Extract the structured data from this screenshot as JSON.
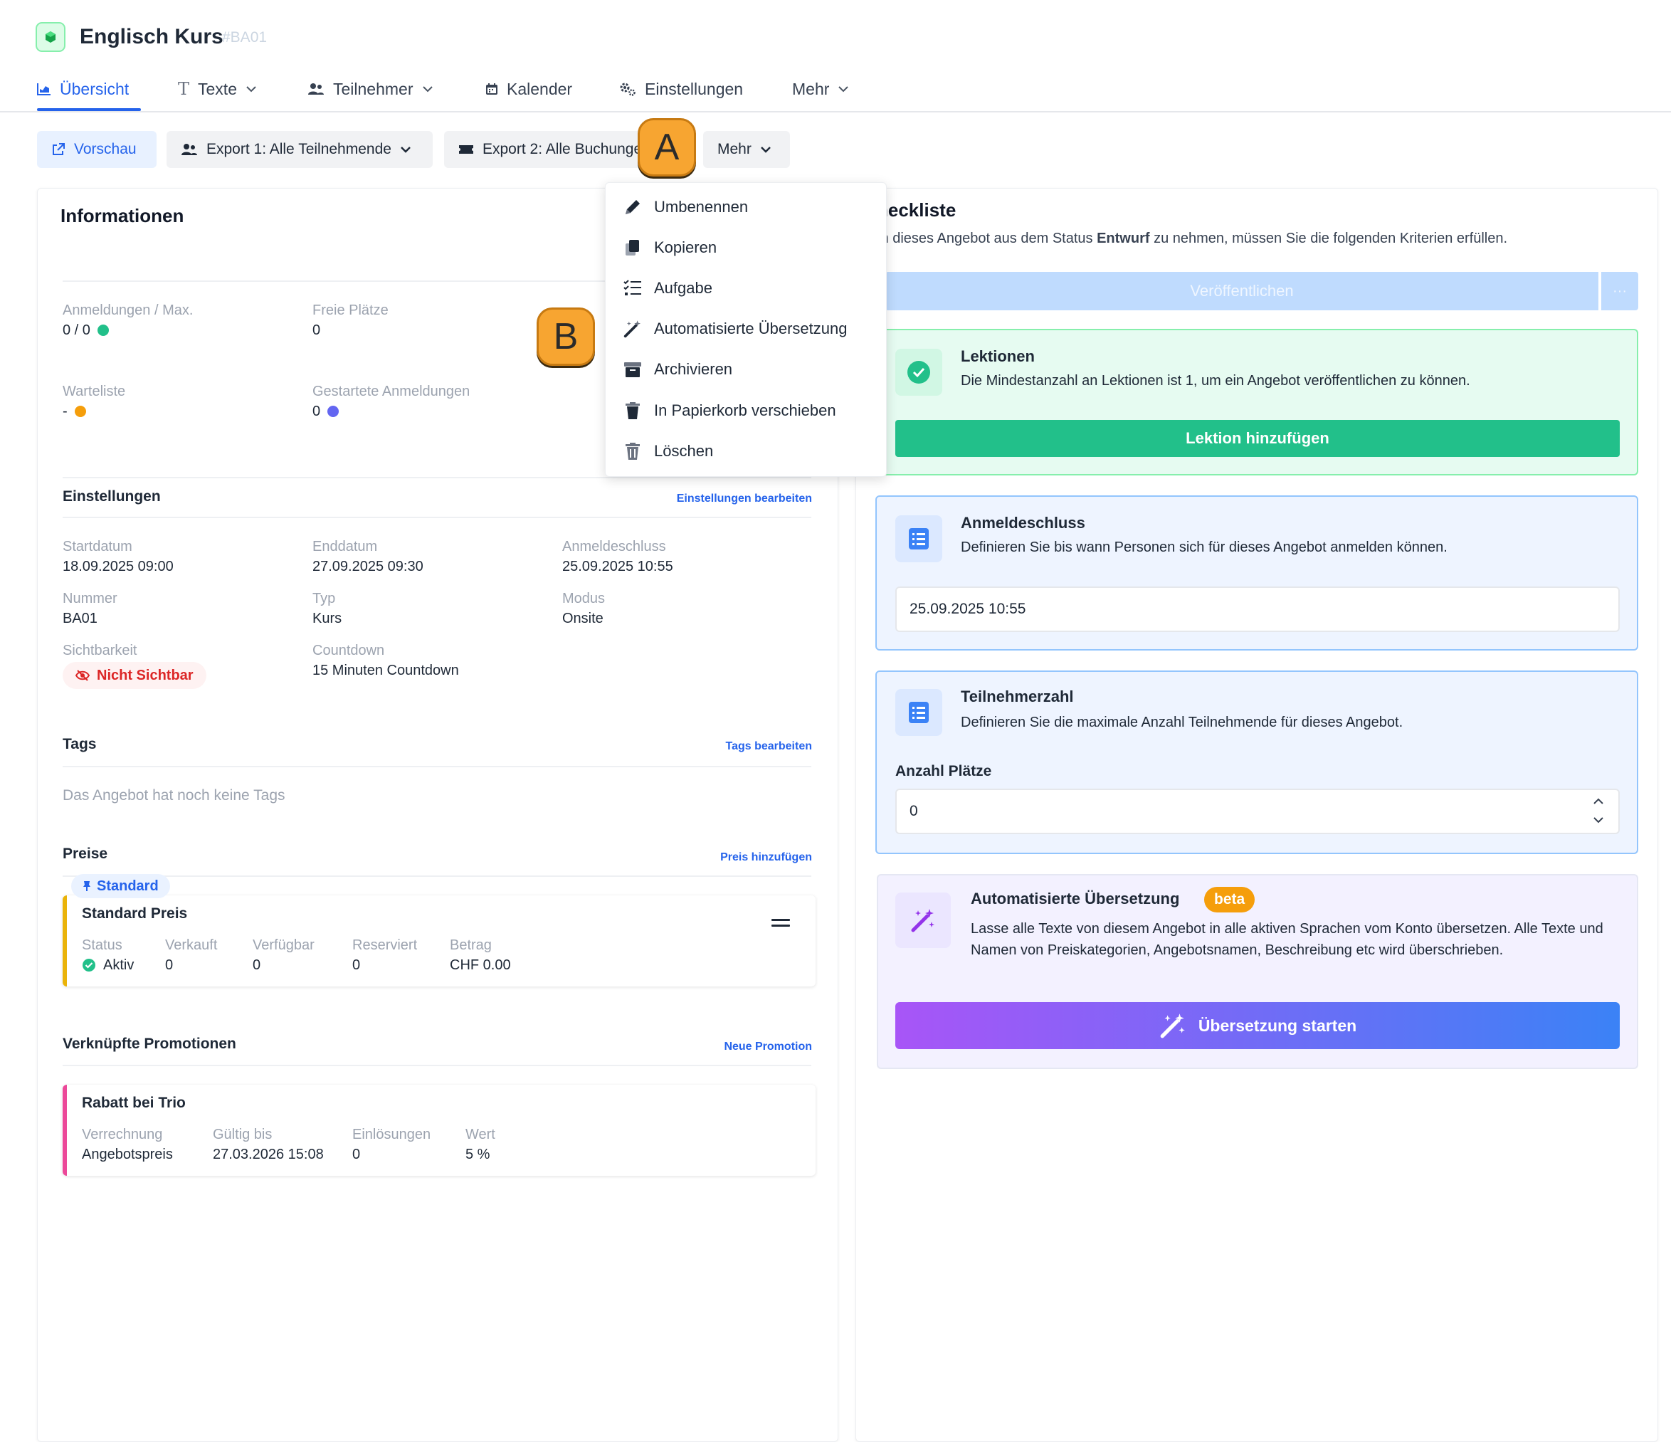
{
  "header": {
    "title": "Englisch Kurs",
    "code": "#BA01"
  },
  "tabs": [
    {
      "label": "Übersicht",
      "icon": "chart-icon",
      "active": true
    },
    {
      "label": "Texte",
      "icon": "text-icon",
      "dropdown": true
    },
    {
      "label": "Teilnehmer",
      "icon": "users-icon",
      "dropdown": true
    },
    {
      "label": "Kalender",
      "icon": "calendar-icon"
    },
    {
      "label": "Einstellungen",
      "icon": "gears-icon"
    },
    {
      "label": "Mehr",
      "dropdown": true
    }
  ],
  "toolbar": {
    "preview": "Vorschau",
    "export1": "Export 1: Alle Teilnehmende",
    "export2": "Export 2: Alle Buchunge",
    "more": "Mehr"
  },
  "markers": {
    "a": "A",
    "b": "B"
  },
  "menu": [
    {
      "label": "Umbenennen",
      "icon": "pencil-icon"
    },
    {
      "label": "Kopieren",
      "icon": "copy-icon"
    },
    {
      "label": "Aufgabe",
      "icon": "task-list-icon"
    },
    {
      "label": "Automatisierte Übersetzung",
      "icon": "magic-wand-icon"
    },
    {
      "label": "Archivieren",
      "icon": "archive-icon"
    },
    {
      "label": "In Papierkorb verschieben",
      "icon": "trash-icon"
    },
    {
      "label": "Löschen",
      "icon": "trash-delete-icon"
    }
  ],
  "info": {
    "title": "Informationen",
    "stats": [
      {
        "label": "Anmeldungen / Max.",
        "value": "0 / 0",
        "dot": "#22c08a"
      },
      {
        "label": "Freie Plätze",
        "value": "0"
      },
      {
        "label": "Warteliste",
        "value": "-",
        "dot": "#f59e0b"
      },
      {
        "label": "Gestartete Anmeldungen",
        "value": "0",
        "dot": "#6366f1"
      }
    ]
  },
  "settings": {
    "title": "Einstellungen",
    "edit": "Einstellungen bearbeiten",
    "fields": [
      {
        "label": "Startdatum",
        "value": "18.09.2025 09:00"
      },
      {
        "label": "Enddatum",
        "value": "27.09.2025 09:30"
      },
      {
        "label": "Anmeldeschluss",
        "value": "25.09.2025 10:55"
      },
      {
        "label": "Nummer",
        "value": "BA01"
      },
      {
        "label": "Typ",
        "value": "Kurs"
      },
      {
        "label": "Modus",
        "value": "Onsite"
      },
      {
        "label": "Sichtbarkeit",
        "value": "Nicht Sichtbar"
      },
      {
        "label": "Countdown",
        "value": "15 Minuten Countdown"
      }
    ]
  },
  "tags": {
    "title": "Tags",
    "edit": "Tags bearbeiten",
    "empty": "Das Angebot hat noch keine Tags"
  },
  "prices": {
    "title": "Preise",
    "add": "Preis hinzufügen",
    "badge": "Standard",
    "card": {
      "name": "Standard Preis",
      "cols": [
        {
          "label": "Status",
          "value": "Aktiv"
        },
        {
          "label": "Verkauft",
          "value": "0"
        },
        {
          "label": "Verfügbar",
          "value": "0"
        },
        {
          "label": "Reserviert",
          "value": "0"
        },
        {
          "label": "Betrag",
          "value": "CHF 0.00"
        }
      ]
    }
  },
  "promotions": {
    "title": "Verknüpfte Promotionen",
    "add": "Neue Promotion",
    "card": {
      "name": "Rabatt bei Trio",
      "cols": [
        {
          "label": "Verrechnung",
          "value": "Angebotspreis"
        },
        {
          "label": "Gültig bis",
          "value": "27.03.2026 15:08"
        },
        {
          "label": "Einlösungen",
          "value": "0"
        },
        {
          "label": "Wert",
          "value": "5 %"
        }
      ]
    }
  },
  "checklist": {
    "title": "heckliste",
    "subtitle_pre": "m dieses Angebot aus dem Status ",
    "subtitle_bold": "Entwurf",
    "subtitle_post": " zu nehmen, müssen Sie die folgenden Kriterien erfüllen.",
    "publish": "Veröffentlichen",
    "publish_more": "···",
    "lessons": {
      "title": "Lektionen",
      "text": "Die Mindestanzahl an Lektionen ist 1, um ein Angebot veröffentlichen zu können.",
      "button": "Lektion hinzufügen"
    },
    "deadline": {
      "title": "Anmeldeschluss",
      "text": "Definieren Sie bis wann Personen sich für dieses Angebot anmelden können.",
      "value": "25.09.2025 10:55"
    },
    "participants": {
      "title": "Teilnehmerzahl",
      "text": "Definieren Sie die maximale Anzahl Teilnehmende für dieses Angebot.",
      "field_label": "Anzahl Plätze",
      "value": "0"
    },
    "translation": {
      "title": "Automatisierte Übersetzung",
      "badge": "beta",
      "text": "Lasse alle Texte von diesem Angebot in alle aktiven Sprachen vom Konto übersetzen. Alle Texte und Namen von Preiskategorien, Angebotsnamen, Beschreibung etc wird überschrieben.",
      "button": "Übersetzung starten"
    }
  },
  "colors": {
    "accent": "#2563eb",
    "success": "#22c08a",
    "warning": "#f59e0b",
    "danger": "#dc2626"
  }
}
